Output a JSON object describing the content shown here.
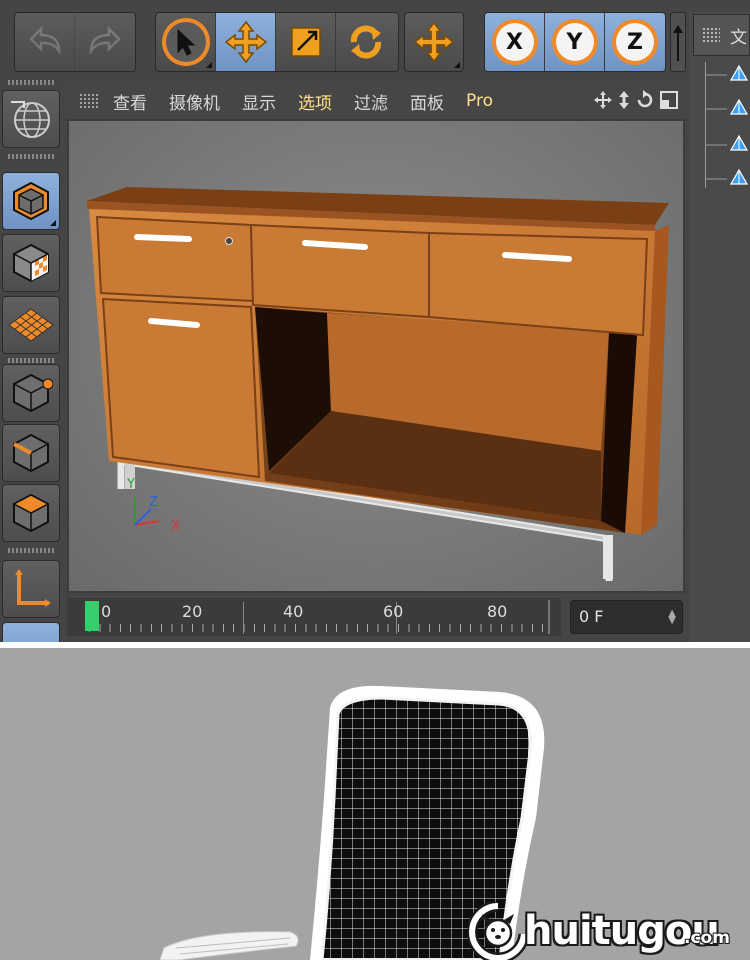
{
  "toolbar": {
    "undo_label": "undo",
    "redo_label": "redo",
    "tools": [
      "select-arrow",
      "move",
      "scale",
      "rotate",
      "transform"
    ],
    "axes": [
      "X",
      "Y",
      "Z"
    ]
  },
  "viewport": {
    "menu": [
      {
        "label": "查看",
        "highlight": false
      },
      {
        "label": "摄像机",
        "highlight": false
      },
      {
        "label": "显示",
        "highlight": false
      },
      {
        "label": "选项",
        "highlight": true
      },
      {
        "label": "过滤",
        "highlight": false
      },
      {
        "label": "面板",
        "highlight": false
      },
      {
        "label": "Pro",
        "highlight": true
      }
    ],
    "axis_labels": {
      "y": "Y",
      "z": "Z",
      "x": "X"
    }
  },
  "timeline": {
    "ticks": [
      {
        "label": "0"
      },
      {
        "label": "20"
      },
      {
        "label": "40"
      },
      {
        "label": "60"
      },
      {
        "label": "80"
      }
    ],
    "current_frame": "0 F"
  },
  "object_panel": {
    "header": "文"
  },
  "watermark": {
    "brand": "huitugou",
    "domain": ".com"
  },
  "colors": {
    "accent_orange": "#ee8a2a",
    "active_blue": "#7b9fd0",
    "timeline_cursor": "#35d06b",
    "wood": "#c8762f"
  }
}
